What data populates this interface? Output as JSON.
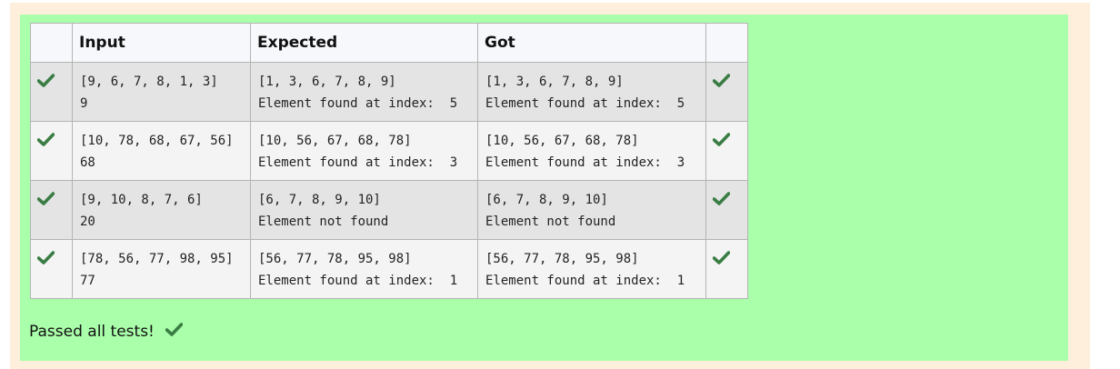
{
  "table": {
    "headers": {
      "status": "",
      "input": "Input",
      "expected": "Expected",
      "got": "Got",
      "result": ""
    },
    "rows": [
      {
        "input": [
          "[9, 6, 7, 8, 1, 3]",
          "9"
        ],
        "expected": [
          "[1, 3, 6, 7, 8, 9]",
          "Element found at index:  5"
        ],
        "got": [
          "[1, 3, 6, 7, 8, 9]",
          "Element found at index:  5"
        ]
      },
      {
        "input": [
          "[10, 78, 68, 67, 56]",
          "68"
        ],
        "expected": [
          "[10, 56, 67, 68, 78]",
          "Element found at index:  3"
        ],
        "got": [
          "[10, 56, 67, 68, 78]",
          "Element found at index:  3"
        ]
      },
      {
        "input": [
          "[9, 10, 8, 7, 6]",
          "20"
        ],
        "expected": [
          "[6, 7, 8, 9, 10]",
          "Element not found"
        ],
        "got": [
          "[6, 7, 8, 9, 10]",
          "Element not found"
        ]
      },
      {
        "input": [
          "[78, 56, 77, 98, 95]",
          "77"
        ],
        "expected": [
          "[56, 77, 78, 95, 98]",
          "Element found at index:  1"
        ],
        "got": [
          "[56, 77, 78, 95, 98]",
          "Element found at index:  1"
        ]
      }
    ]
  },
  "footer": {
    "message": "Passed all tests!"
  },
  "colors": {
    "check": "#3a7d44",
    "panel": "#aaffaa",
    "outer": "#fdefdb"
  },
  "icons": {
    "status": "checkmark-icon"
  }
}
